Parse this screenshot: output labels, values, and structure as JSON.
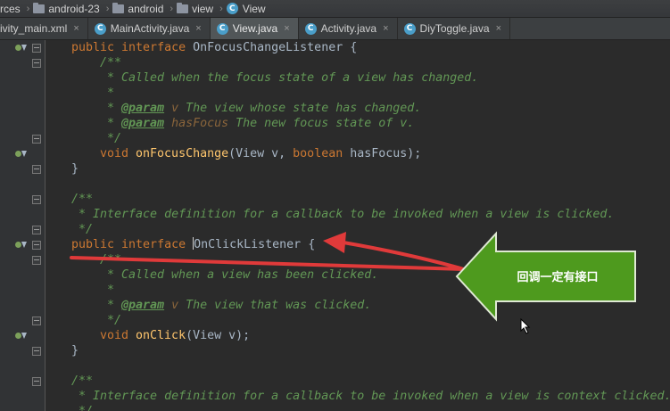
{
  "breadcrumb": {
    "items": [
      "rces",
      "android-23",
      "android",
      "view",
      "View"
    ]
  },
  "tabs": [
    {
      "label": "ivity_main.xml",
      "icon": "xml-file-icon",
      "active": false
    },
    {
      "label": "MainActivity.java",
      "icon": "class-icon",
      "active": false
    },
    {
      "label": "View.java",
      "icon": "class-icon",
      "active": true
    },
    {
      "label": "Activity.java",
      "icon": "class-icon",
      "active": false
    },
    {
      "label": "DiyToggle.java",
      "icon": "class-icon",
      "active": false
    }
  ],
  "code": {
    "l1_kw": "public interface ",
    "l1_name": "OnFocusChangeListener {",
    "l2": "/**",
    "l3": " * Called when the focus state of a view has changed.",
    "l4": " *",
    "l5_pre": " * ",
    "l5_tag": "@param",
    "l5_param": " v",
    "l5_rest": " The view whose state has changed.",
    "l6_pre": " * ",
    "l6_tag": "@param",
    "l6_param": " hasFocus",
    "l6_rest": " The new focus state of v.",
    "l7": " */",
    "l8_kw": "void ",
    "l8_fn": "onFocusChange",
    "l8_a": "(View v, ",
    "l8_kw2": "boolean",
    "l8_b": " hasFocus);",
    "l9": "}",
    "l11": "/**",
    "l12": " * Interface definition for a callback to be invoked when a view is clicked.",
    "l13": " */",
    "l14_kw": "public interface ",
    "l14_c1": "O",
    "l14_name": "nClickListener {",
    "l15": "/**",
    "l16": " * Called when a view has been clicked.",
    "l17": " *",
    "l18_pre": " * ",
    "l18_tag": "@param",
    "l18_param": " v",
    "l18_rest": " The view that was clicked.",
    "l19": " */",
    "l20_kw": "void ",
    "l20_fn": "onClick",
    "l20_rest": "(View v);",
    "l21": "}",
    "l23": "/**",
    "l24": " * Interface definition for a callback to be invoked when a view is context clicked.",
    "l25": " */"
  },
  "annotation": {
    "callout_text": "回调一定有接口",
    "arrow_color": "#e03a3a",
    "callout_color": "#4e9a1e"
  },
  "colors": {
    "background": "#2b2b2b",
    "keyword": "#cc7832",
    "comment": "#629755",
    "function": "#ffc66d",
    "text": "#a9b7c6"
  }
}
